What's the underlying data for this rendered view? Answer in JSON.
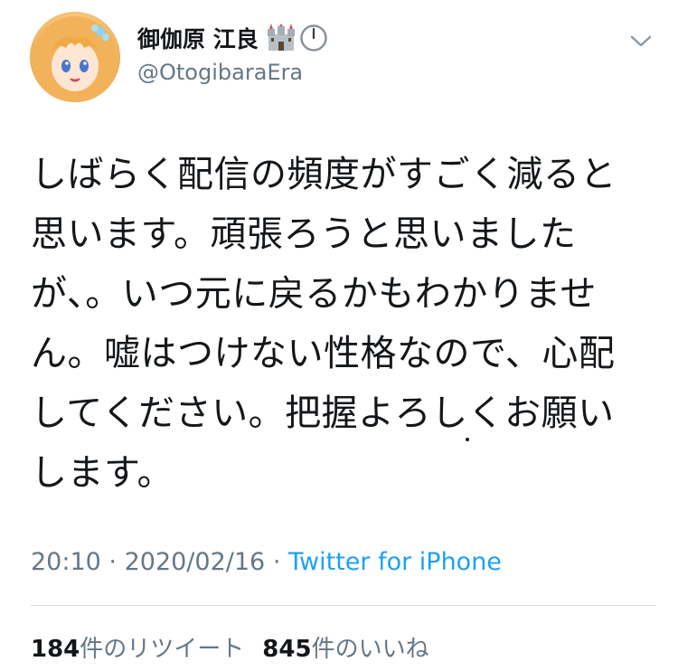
{
  "tweet": {
    "author": {
      "display_name": "御伽原 江良",
      "handle": "@OtogibaraEra",
      "emoji": [
        "castle-emoji",
        "clock-emoji"
      ]
    },
    "text_lines": [
      "しばらく配信の頻度がすごく減ると",
      "思います。頑張ろうと思いました",
      "が、。いつ元に戻るかもわかりませ",
      "ん。嘘はつけない性格なので、心配",
      "してください。把握よろしくお願い",
      "します。"
    ],
    "time": "20:10",
    "separator": "·",
    "date": "2020/02/16",
    "source": "Twitter for iPhone",
    "stats": {
      "retweets_count": "184",
      "retweets_label": "件のリツイート",
      "likes_count": "845",
      "likes_label": "件のいいね"
    }
  },
  "colors": {
    "text": "#14171a",
    "secondary": "#657786",
    "link": "#1da1f2",
    "divider": "#d8dde2"
  }
}
